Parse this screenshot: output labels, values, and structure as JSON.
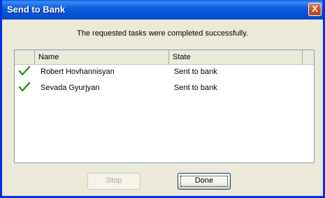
{
  "window": {
    "title": "Send to Bank",
    "close_label": "X"
  },
  "message": "The requested tasks were completed successfully.",
  "list": {
    "columns": [
      "",
      "Name",
      "State"
    ],
    "rows": [
      {
        "icon": "checkmark-icon",
        "name": "Robert Hovhannisyan",
        "state": "Sent to bank"
      },
      {
        "icon": "checkmark-icon",
        "name": "Sevada Gyurjyan",
        "state": "Sent to bank"
      }
    ]
  },
  "buttons": {
    "stop_label": "Stop",
    "done_label": "Done"
  },
  "colors": {
    "titlebar": "#0a5fe0",
    "check": "#1f8a14"
  }
}
